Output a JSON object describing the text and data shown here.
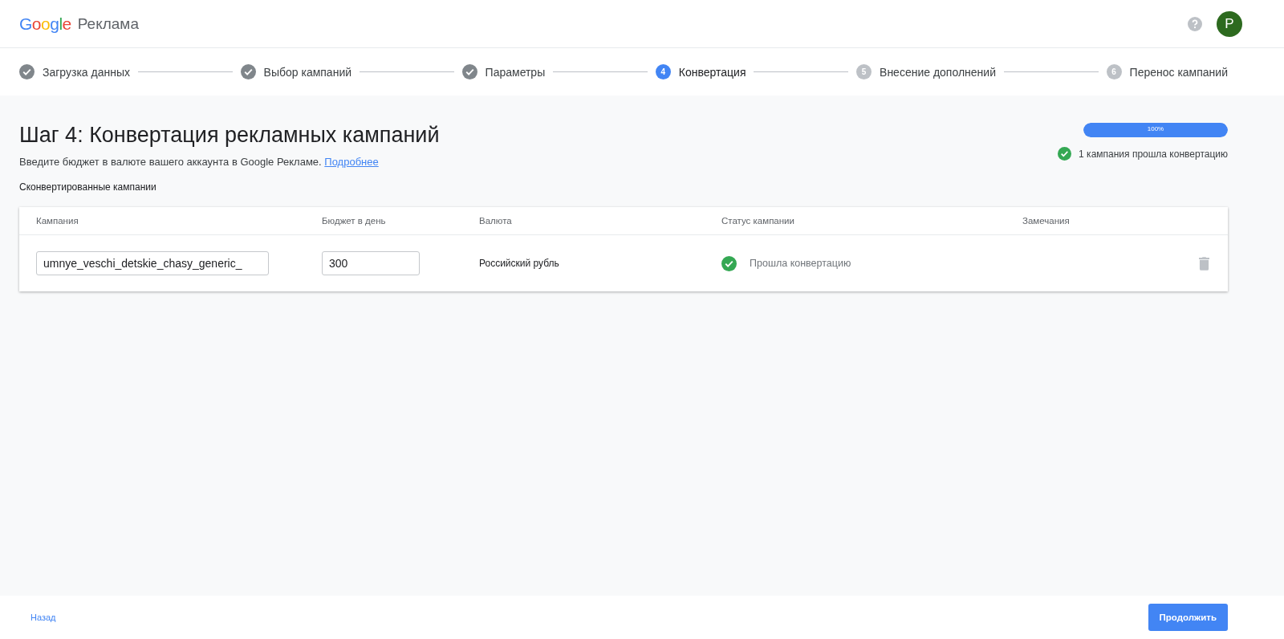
{
  "header": {
    "logo": "Google",
    "product": "Реклама",
    "avatar_letter": "P"
  },
  "steps": [
    {
      "label": "Загрузка данных",
      "done": true,
      "current": false
    },
    {
      "label": "Выбор кампаний",
      "done": true,
      "current": false
    },
    {
      "label": "Параметры",
      "done": true,
      "current": false
    },
    {
      "number": "4",
      "label": "Конвертация",
      "done": false,
      "current": true
    },
    {
      "number": "5",
      "label": "Внесение дополнений",
      "done": false,
      "current": false
    },
    {
      "number": "6",
      "label": "Перенос кампаний",
      "done": false,
      "current": false
    }
  ],
  "page": {
    "title": "Шаг 4: Конвертация рекламных кампаний",
    "subtitle": "Введите бюджет в валюте вашего аккаунта в Google Рекламе.",
    "link": "Подробнее",
    "progress": {
      "level": 1,
      "label": "100%"
    },
    "summary": "1 кампания прошла конвертацию"
  },
  "section_title": "Сконвертированные кампании",
  "table": {
    "columns": [
      "Кампания",
      "Бюджет в день",
      "Валюта",
      "Статус кампании",
      "Замечания"
    ],
    "rows": [
      {
        "campaign": "umnye_veschi_detskie_chasy_generic_",
        "budget": "300",
        "currency": "Российский рубль",
        "status": "Прошла конвертацию",
        "converted": true
      }
    ]
  },
  "footer": {
    "back": "Назад",
    "next": "Продолжить"
  }
}
